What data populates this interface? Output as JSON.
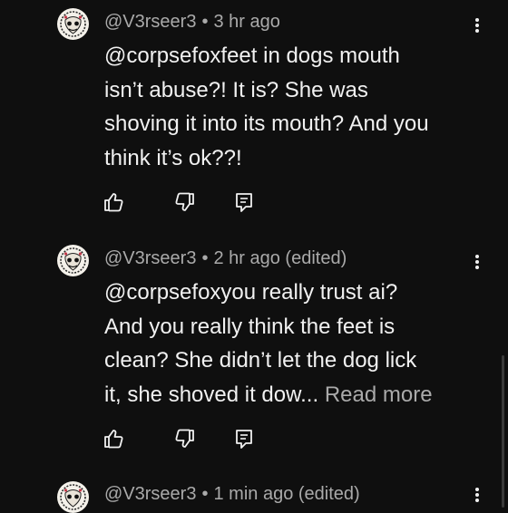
{
  "comments": [
    {
      "author": "@V3rseer3",
      "separator": "•",
      "time": "3 hr ago",
      "text": "@corpsefoxfeet in dogs mouth\nisn’t abuse?! It is? She was\nshoving it into its mouth? And you\nthink it’s ok??!",
      "read_more": "",
      "icons": [
        "thumbs-up-icon",
        "thumbs-down-icon",
        "reply-icon",
        "more-options-icon"
      ]
    },
    {
      "author": "@V3rseer3",
      "separator": "•",
      "time": "2 hr ago (edited)",
      "text": "@corpsefoxyou really trust ai?\nAnd you really think the feet is\nclean? She didn’t let the dog lick\nit, she shoved it dow... ",
      "read_more": "Read more",
      "icons": [
        "thumbs-up-icon",
        "thumbs-down-icon",
        "reply-icon",
        "more-options-icon"
      ]
    },
    {
      "author": "@V3rseer3",
      "separator": "•",
      "time": "1 min ago (edited)",
      "text": "",
      "read_more": "",
      "icons": [
        "more-options-icon"
      ]
    }
  ],
  "colors": {
    "background": "#0f0f0f",
    "primary_text": "#f1f1f1",
    "secondary_text": "#aaaaaa",
    "avatar_bg": "#f4f1ea"
  }
}
